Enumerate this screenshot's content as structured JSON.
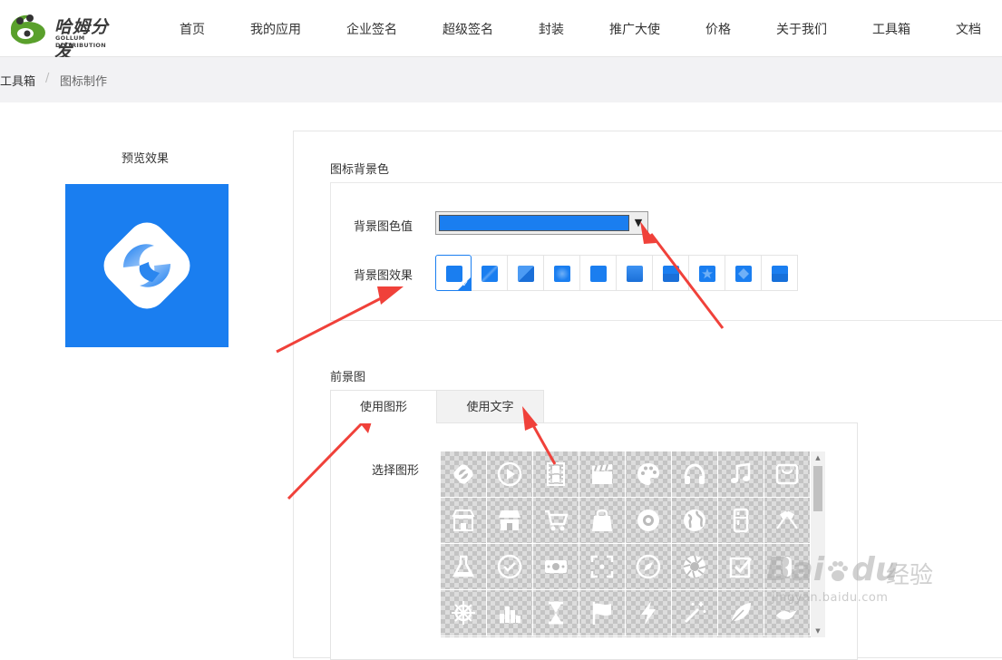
{
  "brand": {
    "name_cn": "哈姆分发",
    "name_en": "GOLLUM DISTRIBUTION"
  },
  "nav": [
    "首页",
    "我的应用",
    "企业签名",
    "超级签名",
    "封装",
    "推广大使",
    "价格",
    "关于我们",
    "工具箱",
    "文档"
  ],
  "breadcrumb": {
    "parent": "工具箱",
    "separator": "/",
    "current": "图标制作"
  },
  "preview": {
    "label": "预览效果",
    "icon_bg_color": "#1a7ef0"
  },
  "background_section": {
    "title": "图标背景色",
    "color_label": "背景图色值",
    "color_value": "#1a7ef0",
    "effect_label": "背景图效果",
    "effect_count": 10,
    "selected_effect_index": 0
  },
  "foreground_section": {
    "title": "前景图",
    "tabs": [
      {
        "label": "使用图形",
        "active": true
      },
      {
        "label": "使用文字",
        "active": false
      }
    ],
    "shape_label": "选择图形",
    "shapes": [
      "ring-swirl-icon",
      "play-circle-icon",
      "film-strip-icon",
      "clapperboard-icon",
      "palette-icon",
      "headphones-icon",
      "music-note-icon",
      "bag-icon",
      "store-icon",
      "shop-awning-icon",
      "cart-icon",
      "shopping-bag-icon",
      "record-icon",
      "globe-icon",
      "fridge-icon",
      "checkered-flags-icon",
      "flask-icon",
      "check-circle-icon",
      "money-icon",
      "focus-frame-icon",
      "compass-icon",
      "aperture-icon",
      "checkbox-icon",
      "tube-icon",
      "helm-icon",
      "equalizer-icon",
      "hourglass-icon",
      "flag-icon",
      "lightning-icon",
      "magic-wand-icon",
      "leaf-icon",
      "bird-icon"
    ]
  },
  "watermark": {
    "brand": "Bai",
    "brand_end": "du",
    "cn": "经验",
    "url": "jingyan.baidu.com"
  },
  "colors": {
    "accent": "#1a7ef0",
    "arrow": "#f0413a"
  }
}
